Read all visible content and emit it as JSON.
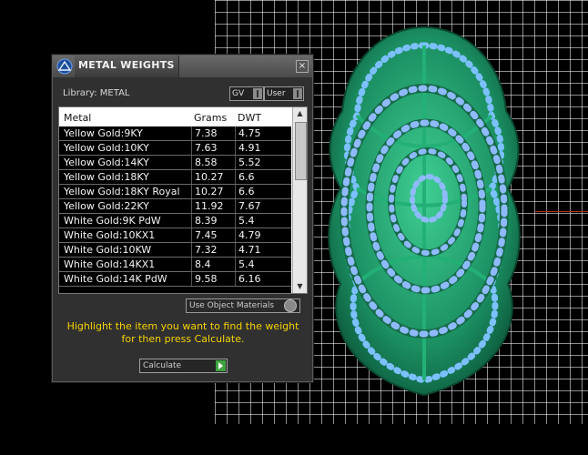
{
  "panel": {
    "title": "METAL WEIGHTS",
    "close_glyph": "×",
    "library_label": "Library: METAL",
    "lib_options": [
      "GV",
      "User"
    ],
    "table": {
      "headers": [
        "Metal",
        "Grams",
        "DWT"
      ],
      "rows": [
        [
          "Yellow Gold:9KY",
          "7.38",
          "4.75"
        ],
        [
          "Yellow Gold:10KY",
          "7.63",
          "4.91"
        ],
        [
          "Yellow Gold:14KY",
          "8.58",
          "5.52"
        ],
        [
          "Yellow Gold:18KY",
          "10.27",
          "6.6"
        ],
        [
          "Yellow Gold:18KY Royal",
          "10.27",
          "6.6"
        ],
        [
          "Yellow Gold:22KY",
          "11.92",
          "7.67"
        ],
        [
          "White Gold:9K PdW",
          "8.39",
          "5.4"
        ],
        [
          "White Gold:10KX1",
          "7.45",
          "4.79"
        ],
        [
          "White Gold:10KW",
          "7.32",
          "4.71"
        ],
        [
          "White Gold:14KX1",
          "8.4",
          "5.4"
        ],
        [
          "White Gold:14K PdW",
          "9.58",
          "6.16"
        ]
      ]
    },
    "use_object_materials": "Use Object Materials",
    "hint": "Highlight the item you want to find the weight for then press Calculate.",
    "calculate_label": "Calculate"
  },
  "icons": {
    "logo": "matrix-logo-icon",
    "close": "close-icon",
    "ring": "jewelry-ring-model"
  },
  "colors": {
    "hint_text": "#f5d200",
    "ring_metal": "#1f9a6a",
    "gem": "#7aa7ff"
  }
}
